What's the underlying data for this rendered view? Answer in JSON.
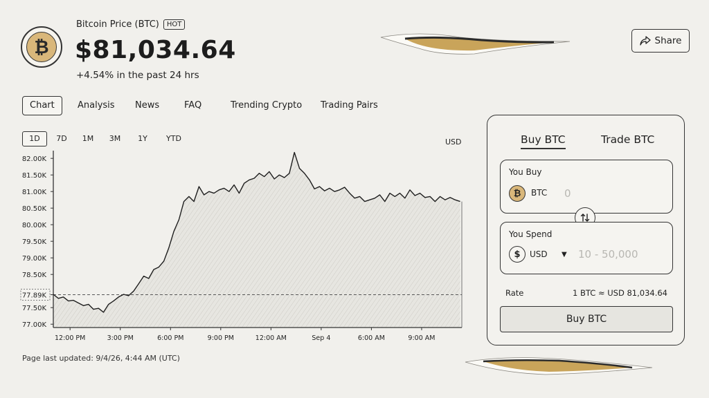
{
  "header": {
    "asset_name": "Bitcoin Price (BTC)",
    "badge": "HOT",
    "price": "$81,034.64",
    "change": "+4.54% in the past 24 hrs",
    "share_label": "Share",
    "logo_icon": "bitcoin-icon",
    "logo_symbol": "₿"
  },
  "tabs": [
    {
      "label": "Chart",
      "active": true
    },
    {
      "label": "Analysis",
      "active": false
    },
    {
      "label": "News",
      "active": false
    },
    {
      "label": "FAQ",
      "active": false
    },
    {
      "label": "Trending Crypto",
      "active": false
    },
    {
      "label": "Trading Pairs",
      "active": false
    }
  ],
  "ranges": [
    {
      "label": "1D",
      "active": true
    },
    {
      "label": "7D",
      "active": false
    },
    {
      "label": "1M",
      "active": false
    },
    {
      "label": "3M",
      "active": false
    },
    {
      "label": "1Y",
      "active": false
    },
    {
      "label": "YTD",
      "active": false
    }
  ],
  "chart_currency": "USD",
  "chart_data": {
    "type": "area",
    "title": "",
    "xlabel": "",
    "ylabel": "",
    "ylim": [
      76900,
      82150
    ],
    "y_ticks": [
      {
        "value": 82000,
        "label": "82.00K"
      },
      {
        "value": 81500,
        "label": "81.50K"
      },
      {
        "value": 81000,
        "label": "81.00K"
      },
      {
        "value": 80500,
        "label": "80.50K"
      },
      {
        "value": 80000,
        "label": "80.00K"
      },
      {
        "value": 79500,
        "label": "79.50K"
      },
      {
        "value": 79000,
        "label": "79.00K"
      },
      {
        "value": 78500,
        "label": "78.50K"
      },
      {
        "value": 77890,
        "label": "77.89K"
      },
      {
        "value": 77500,
        "label": "77.50K"
      },
      {
        "value": 77000,
        "label": "77.00K"
      }
    ],
    "x_ticks": [
      {
        "value": 1,
        "label": "12:00 PM"
      },
      {
        "value": 4,
        "label": "3:00 PM"
      },
      {
        "value": 7,
        "label": "6:00 PM"
      },
      {
        "value": 10,
        "label": "9:00 PM"
      },
      {
        "value": 13,
        "label": "12:00 AM"
      },
      {
        "value": 16,
        "label": "Sep 4"
      },
      {
        "value": 19,
        "label": "6:00 AM"
      },
      {
        "value": 22,
        "label": "9:00 AM"
      }
    ],
    "xlim": [
      0,
      24.4
    ],
    "reference_line": {
      "value": 77890,
      "label": "77.89K",
      "style": "dashed"
    },
    "series": [
      {
        "x": [
          0,
          0.3,
          0.6,
          0.9,
          1.2,
          1.5,
          1.8,
          2.1,
          2.4,
          2.7,
          3.0,
          3.3,
          3.6,
          3.9,
          4.2,
          4.5,
          4.8,
          5.1,
          5.4,
          5.7,
          6.0,
          6.3,
          6.6,
          6.9,
          7.2,
          7.5,
          7.8,
          8.1,
          8.4,
          8.7,
          9.0,
          9.3,
          9.6,
          9.9,
          10.2,
          10.5,
          10.8,
          11.1,
          11.4,
          11.7,
          12.0,
          12.3,
          12.6,
          12.9,
          13.2,
          13.5,
          13.8,
          14.1,
          14.4,
          14.7,
          15.0,
          15.3,
          15.6,
          15.9,
          16.2,
          16.5,
          16.8,
          17.1,
          17.4,
          17.7,
          18.0,
          18.3,
          18.6,
          18.9,
          19.2,
          19.5,
          19.8,
          20.1,
          20.4,
          20.7,
          21.0,
          21.3,
          21.6,
          21.9,
          22.2,
          22.5,
          22.8,
          23.1,
          23.4,
          23.7,
          24.0,
          24.3
        ],
        "values": [
          77900,
          77780,
          77820,
          77700,
          77720,
          77640,
          77560,
          77600,
          77450,
          77480,
          77360,
          77600,
          77700,
          77820,
          77900,
          77860,
          78000,
          78220,
          78450,
          78380,
          78650,
          78720,
          78900,
          79300,
          79800,
          80150,
          80700,
          80850,
          80700,
          81150,
          80900,
          81000,
          80950,
          81050,
          81100,
          81000,
          81200,
          80950,
          81250,
          81350,
          81400,
          81550,
          81450,
          81600,
          81380,
          81500,
          81420,
          81550,
          82180,
          81700,
          81550,
          81350,
          81080,
          81150,
          81020,
          81100,
          81000,
          81050,
          81130,
          80950,
          80800,
          80850,
          80700,
          80750,
          80800,
          80900,
          80700,
          80950,
          80850,
          80950,
          80800,
          81050,
          80880,
          80950,
          80820,
          80850,
          80700,
          80850,
          80750,
          80820,
          80750,
          80700
        ]
      }
    ]
  },
  "updated": "Page last updated: 9/4/26, 4:44 AM (UTC)",
  "trade": {
    "tabs": {
      "active": "Buy BTC",
      "other": "Trade BTC"
    },
    "buy": {
      "label": "You Buy",
      "asset": "BTC",
      "placeholder": "0",
      "icon": "bitcoin-icon",
      "symbol": "₿"
    },
    "spend": {
      "label": "You Spend",
      "currency": "USD",
      "placeholder": "10 - 50,000",
      "icon": "dollar-icon",
      "symbol": "$"
    },
    "swap_icon": "swap-arrows-icon",
    "rate_label": "Rate",
    "rate_value": "1 BTC ≈ USD 81,034.64",
    "buy_button": "Buy BTC"
  },
  "colors": {
    "background": "#f1f0ec",
    "ink": "#222222",
    "bitcoin": "#d9b77a",
    "torn_gold": "#c9a45a"
  }
}
